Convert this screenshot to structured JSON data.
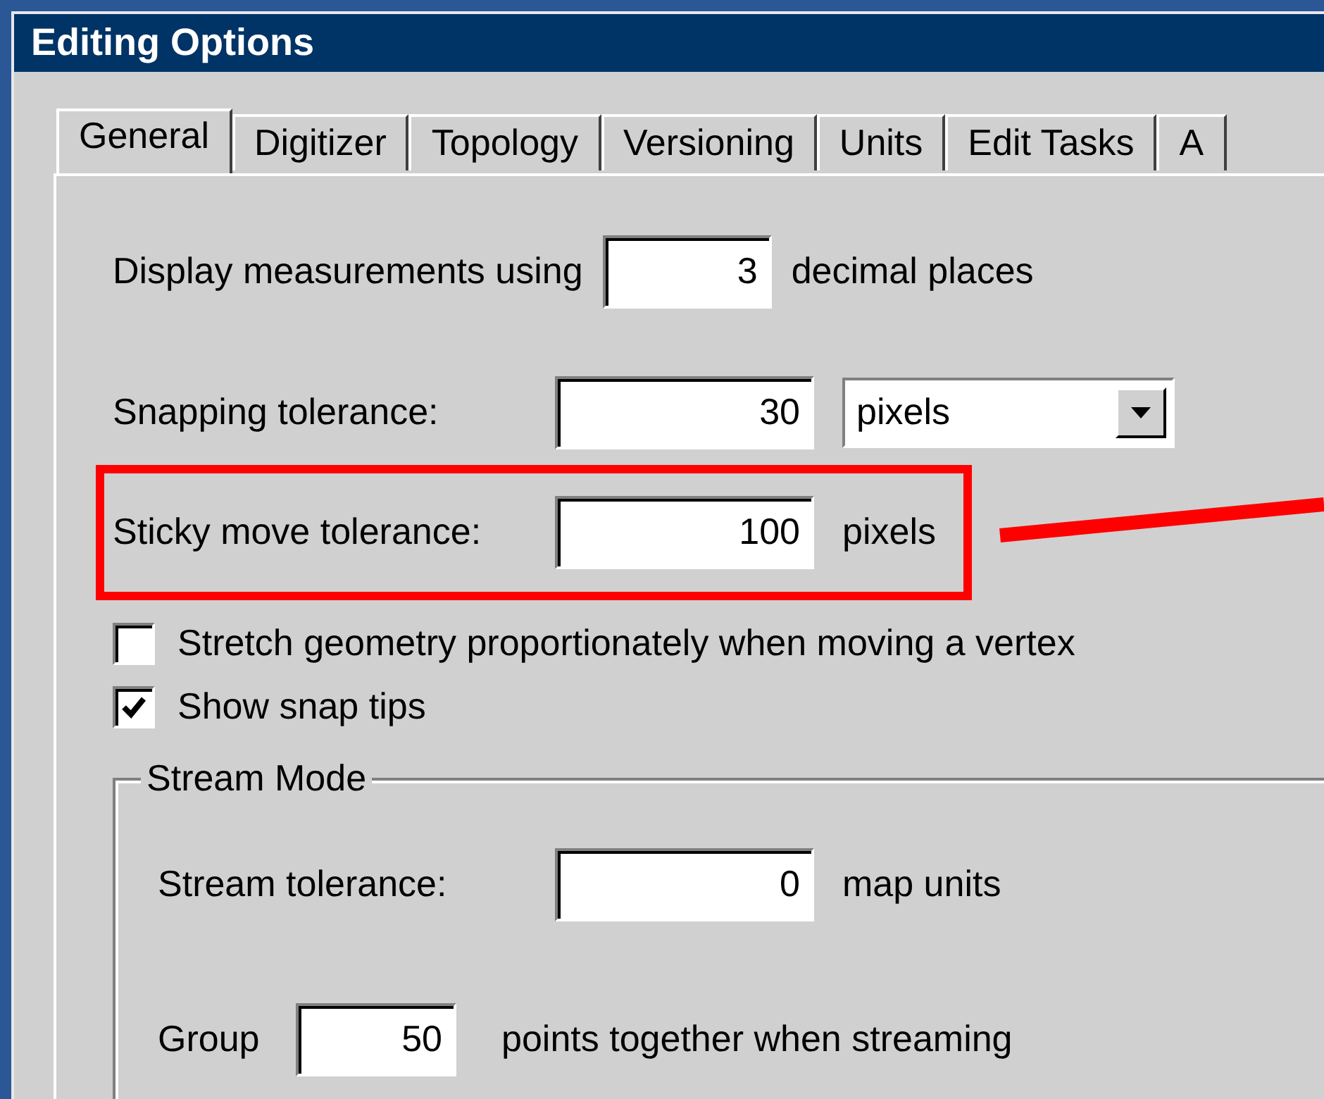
{
  "window": {
    "title": "Editing Options"
  },
  "tabs": [
    {
      "label": "General",
      "selected": true
    },
    {
      "label": "Digitizer",
      "selected": false
    },
    {
      "label": "Topology",
      "selected": false
    },
    {
      "label": "Versioning",
      "selected": false
    },
    {
      "label": "Units",
      "selected": false
    },
    {
      "label": "Edit Tasks",
      "selected": false
    },
    {
      "label": "A",
      "selected": false
    }
  ],
  "decimal_places": {
    "label": "Display measurements using",
    "value": "3",
    "suffix": "decimal places"
  },
  "snapping_tolerance": {
    "label": "Snapping tolerance:",
    "value": "30",
    "unit": "pixels"
  },
  "sticky_move_tolerance": {
    "label": "Sticky move tolerance:",
    "value": "100",
    "unit": "pixels",
    "highlighted": true
  },
  "checkboxes": [
    {
      "label": "Stretch geometry proportionately when moving a vertex",
      "checked": false
    },
    {
      "label": "Show snap tips",
      "checked": true
    }
  ],
  "stream_mode": {
    "title": "Stream Mode",
    "stream_tolerance": {
      "label": "Stream tolerance:",
      "value": "0",
      "unit": "map units"
    },
    "group": {
      "label": "Group",
      "value": "50",
      "suffix": "points together when streaming"
    }
  }
}
